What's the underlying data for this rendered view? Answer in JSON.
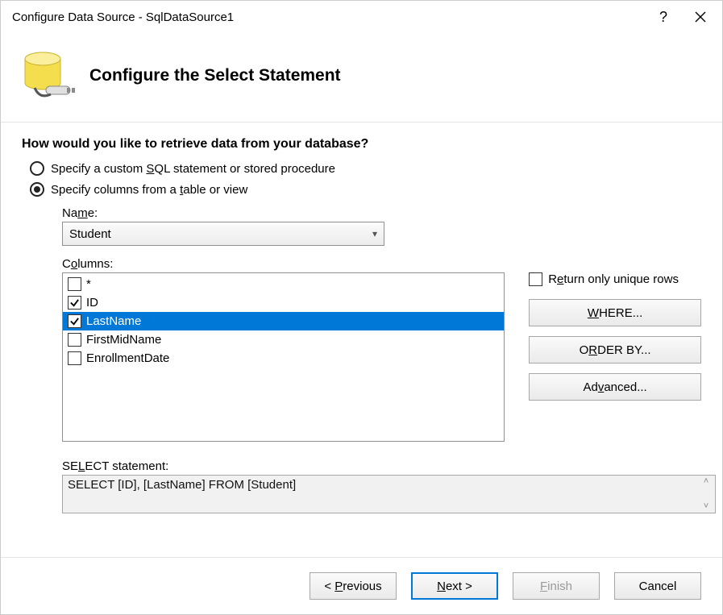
{
  "titlebar": {
    "title": "Configure Data Source - SqlDataSource1"
  },
  "header": {
    "heading": "Configure the Select Statement"
  },
  "body": {
    "question": "How would you like to retrieve data from your database?",
    "radios": {
      "custom": {
        "pre": "Specify a custom ",
        "u": "S",
        "mid": "QL statement or stored procedure",
        "selected": false
      },
      "columns": {
        "pre": "Specify columns from a ",
        "u": "t",
        "mid": "able or view",
        "selected": true
      }
    },
    "name_label_pre": "Na",
    "name_label_u": "m",
    "name_label_post": "e:",
    "table_name": "Student",
    "columns_label_pre": "C",
    "columns_label_u": "o",
    "columns_label_post": "lumns:",
    "columns": [
      {
        "label": "*",
        "checked": false,
        "selected": false
      },
      {
        "label": "ID",
        "checked": true,
        "selected": false
      },
      {
        "label": "LastName",
        "checked": true,
        "selected": true
      },
      {
        "label": "FirstMidName",
        "checked": false,
        "selected": false
      },
      {
        "label": "EnrollmentDate",
        "checked": false,
        "selected": false
      }
    ],
    "unique": {
      "pre": "R",
      "u": "e",
      "post": "turn only unique rows",
      "checked": false
    },
    "buttons": {
      "where": {
        "u": "W",
        "post": "HERE..."
      },
      "orderby": {
        "pre": "O",
        "u": "R",
        "post": "DER BY..."
      },
      "advanced": {
        "pre": "Ad",
        "u": "v",
        "post": "anced..."
      }
    },
    "select_label_pre": "SE",
    "select_label_u": "L",
    "select_label_post": "ECT statement:",
    "select_statement": "SELECT [ID], [LastName] FROM [Student]"
  },
  "footer": {
    "previous": {
      "pre": "< ",
      "u": "P",
      "post": "revious"
    },
    "next": {
      "u": "N",
      "post": "ext >"
    },
    "finish": {
      "u": "F",
      "post": "inish"
    },
    "cancel": {
      "text": "Cancel"
    }
  }
}
